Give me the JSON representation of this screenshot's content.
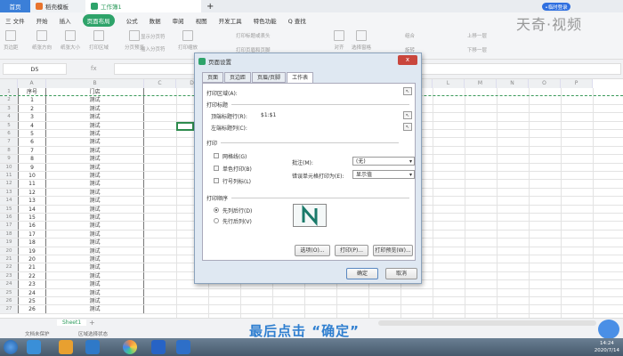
{
  "tabs": {
    "home": "首页",
    "template": "稻壳模板",
    "workbook": "工作簿1",
    "login": "•临时登录"
  },
  "menu": [
    "三 文件",
    "开始",
    "插入",
    "页面布局",
    "公式",
    "数据",
    "审阅",
    "视图",
    "开发工具",
    "特色功能",
    "Q 查找"
  ],
  "menu_active_index": 3,
  "ribbon": [
    "页边距",
    "纸张方向",
    "纸张大小",
    "打印区域",
    "分页预览",
    "显示分页符",
    "插入分页符",
    "打印缩放",
    "打印标题或表头",
    "打印页眉和页脚",
    "对齐",
    "旋转",
    "选择窗格",
    "组合",
    "上移一层",
    "下移一层"
  ],
  "watermark": "天奇·视频",
  "formula": {
    "name_box": "D5",
    "fx": "fx"
  },
  "columns": [
    "A",
    "B",
    "C",
    "D",
    "E",
    "F",
    "G",
    "H",
    "I",
    "J",
    "K",
    "L",
    "M",
    "N",
    "O",
    "P"
  ],
  "sheet": {
    "header": [
      "序号",
      "门店"
    ],
    "rows": [
      [
        "1",
        "测试"
      ],
      [
        "2",
        "测试"
      ],
      [
        "3",
        "测试"
      ],
      [
        "4",
        "测试"
      ],
      [
        "5",
        "测试"
      ],
      [
        "6",
        "测试"
      ],
      [
        "7",
        "测试"
      ],
      [
        "8",
        "测试"
      ],
      [
        "9",
        "测试"
      ],
      [
        "10",
        "测试"
      ],
      [
        "11",
        "测试"
      ],
      [
        "12",
        "测试"
      ],
      [
        "13",
        "测试"
      ],
      [
        "14",
        "测试"
      ],
      [
        "15",
        "测试"
      ],
      [
        "16",
        "测试"
      ],
      [
        "17",
        "测试"
      ],
      [
        "18",
        "测试"
      ],
      [
        "19",
        "测试"
      ],
      [
        "20",
        "测试"
      ],
      [
        "21",
        "测试"
      ],
      [
        "22",
        "测试"
      ],
      [
        "23",
        "测试"
      ],
      [
        "24",
        "测试"
      ],
      [
        "25",
        "测试"
      ],
      [
        "26",
        "测试"
      ]
    ]
  },
  "sheet_tab": "Sheet1",
  "status": {
    "protect": "文档未保护",
    "mode": "区域选择状态"
  },
  "caption": "最后点击 “确定”",
  "clock": {
    "time": "14:24",
    "date": "2020/7/14"
  },
  "dialog": {
    "title": "页面设置",
    "tabs": [
      "页面",
      "页边距",
      "页眉/页脚",
      "工作表"
    ],
    "print_area_label": "打印区域(A):",
    "print_titles_section": "打印标题",
    "top_rows_label": "顶端标题行(R):",
    "top_rows_value": "$1:$1",
    "left_cols_label": "左端标题列(C):",
    "print_section": "打印",
    "gridlines": "网格线(G)",
    "mono": "单色打印(B)",
    "rowcol": "行号列标(L)",
    "comments_label": "批注(M):",
    "comments_value": "(无)",
    "errors_label": "错误单元格打印为(E):",
    "errors_value": "显示值",
    "order_section": "打印顺序",
    "order_down": "先列后行(D)",
    "order_over": "先行后列(V)",
    "options_btn": "选项(O)...",
    "print_btn": "打印(P)...",
    "preview_btn": "打印预览(W)...",
    "ok_btn": "确定",
    "cancel_btn": "取消",
    "close": "x"
  }
}
